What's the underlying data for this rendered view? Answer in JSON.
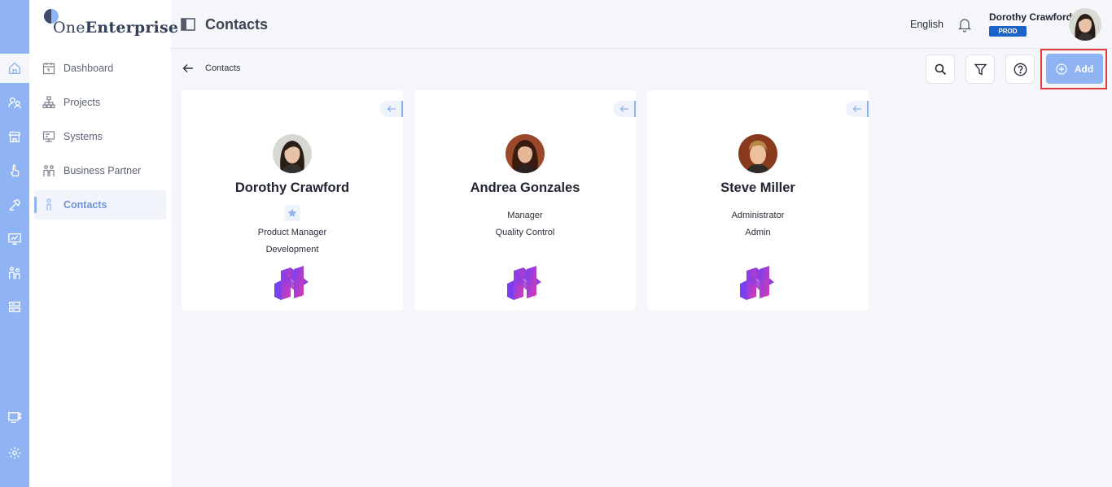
{
  "app": {
    "logo_prefix": "One",
    "logo_bold": "Enterprise",
    "brand_color": "#8fb3f3"
  },
  "rail": {
    "icons": [
      "home-icon",
      "users-icon",
      "store-icon",
      "hand-icon",
      "hammer-icon",
      "monitor-chart-icon",
      "people-icon",
      "server-icon",
      "monitor-grid-icon",
      "settings-icon"
    ]
  },
  "sidebar": {
    "items": [
      {
        "label": "Dashboard",
        "icon": "calendar-icon"
      },
      {
        "label": "Projects",
        "icon": "sitemap-icon"
      },
      {
        "label": "Systems",
        "icon": "systems-icon"
      },
      {
        "label": "Business Partner",
        "icon": "partners-icon"
      },
      {
        "label": "Contacts",
        "icon": "person-icon",
        "active": true
      }
    ]
  },
  "header": {
    "title": "Contacts",
    "language": "English",
    "user_name": "Dorothy Crawford",
    "environment": "PROD"
  },
  "breadcrumb": {
    "current": "Contacts"
  },
  "actions": {
    "add_label": "Add"
  },
  "contacts": [
    {
      "name": "Dorothy Crawford",
      "starred": true,
      "role": "Product Manager",
      "department": "Development"
    },
    {
      "name": "Andrea Gonzales",
      "starred": false,
      "role": "Manager",
      "department": "Quality Control"
    },
    {
      "name": "Steve Miller",
      "starred": false,
      "role": "Administrator",
      "department": "Admin"
    }
  ]
}
